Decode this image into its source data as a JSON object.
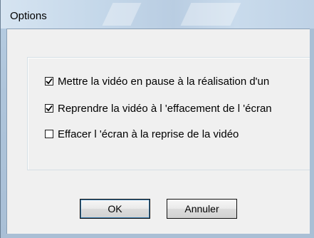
{
  "dialog": {
    "title": "Options"
  },
  "options": [
    {
      "label": "Mettre la vidéo en pause à la réalisation d'un",
      "checked": true
    },
    {
      "label": "Reprendre la vidéo à l 'effacement de l 'écran",
      "checked": true
    },
    {
      "label": "Effacer l 'écran à la reprise de la vidéo",
      "checked": false
    }
  ],
  "buttons": {
    "ok_label": "OK",
    "cancel_label": "Annuler"
  }
}
